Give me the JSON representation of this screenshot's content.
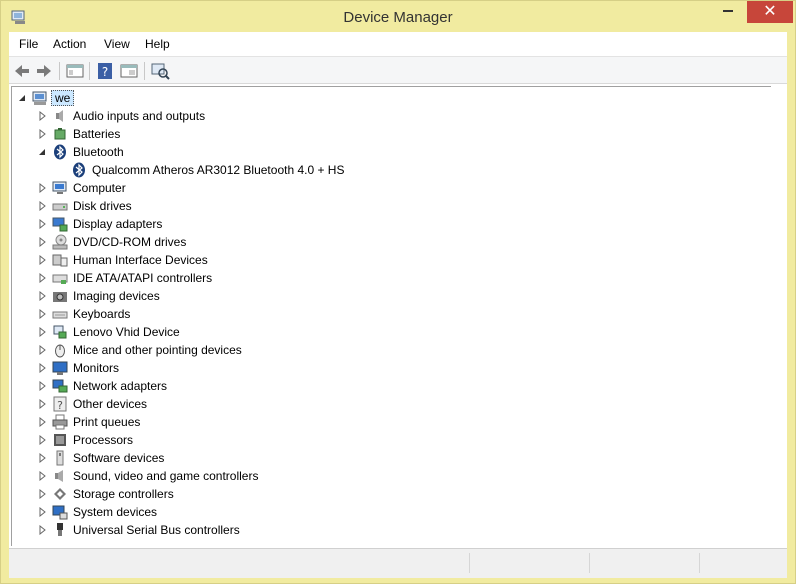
{
  "window": {
    "title": "Device Manager"
  },
  "menu": [
    "File",
    "Action",
    "View",
    "Help"
  ],
  "tree": {
    "root": "we",
    "categories": [
      {
        "label": "Audio inputs and outputs",
        "icon": "speaker-icon",
        "expanded": false
      },
      {
        "label": "Batteries",
        "icon": "battery-icon",
        "expanded": false
      },
      {
        "label": "Bluetooth",
        "icon": "bluetooth-icon",
        "expanded": true,
        "children": [
          "Qualcomm Atheros AR3012 Bluetooth 4.0 + HS"
        ]
      },
      {
        "label": "Computer",
        "icon": "computer-icon",
        "expanded": false
      },
      {
        "label": "Disk drives",
        "icon": "disk-drive-icon",
        "expanded": false
      },
      {
        "label": "Display adapters",
        "icon": "display-adapter-icon",
        "expanded": false
      },
      {
        "label": "DVD/CD-ROM drives",
        "icon": "dvd-drive-icon",
        "expanded": false
      },
      {
        "label": "Human Interface Devices",
        "icon": "hid-icon",
        "expanded": false
      },
      {
        "label": "IDE ATA/ATAPI controllers",
        "icon": "ide-controller-icon",
        "expanded": false
      },
      {
        "label": "Imaging devices",
        "icon": "camera-icon",
        "expanded": false
      },
      {
        "label": "Keyboards",
        "icon": "keyboard-icon",
        "expanded": false
      },
      {
        "label": "Lenovo Vhid Device",
        "icon": "lenovo-device-icon",
        "expanded": false
      },
      {
        "label": "Mice and other pointing devices",
        "icon": "mouse-icon",
        "expanded": false
      },
      {
        "label": "Monitors",
        "icon": "monitor-icon",
        "expanded": false
      },
      {
        "label": "Network adapters",
        "icon": "network-adapter-icon",
        "expanded": false
      },
      {
        "label": "Other devices",
        "icon": "unknown-device-icon",
        "expanded": false
      },
      {
        "label": "Print queues",
        "icon": "printer-icon",
        "expanded": false
      },
      {
        "label": "Processors",
        "icon": "processor-icon",
        "expanded": false
      },
      {
        "label": "Software devices",
        "icon": "software-device-icon",
        "expanded": false
      },
      {
        "label": "Sound, video and game controllers",
        "icon": "sound-icon",
        "expanded": false
      },
      {
        "label": "Storage controllers",
        "icon": "storage-controller-icon",
        "expanded": false
      },
      {
        "label": "System devices",
        "icon": "system-device-icon",
        "expanded": false
      },
      {
        "label": "Universal Serial Bus controllers",
        "icon": "usb-icon",
        "expanded": false
      }
    ]
  },
  "toolbar": [
    "back-icon",
    "forward-icon",
    "show-hide-console-tree-icon",
    "help-icon",
    "properties-icon",
    "scan-hardware-icon"
  ],
  "colors": {
    "frame": "#f1eba0",
    "close": "#c7463a",
    "selection": "#cce8ff"
  }
}
